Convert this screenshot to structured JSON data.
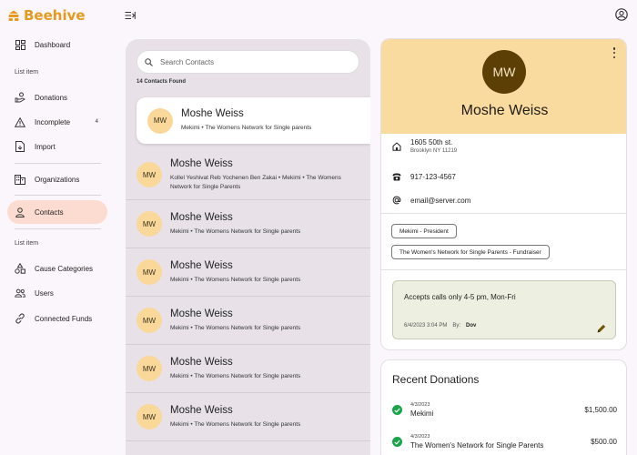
{
  "app": {
    "name": "Beehive",
    "brand_color": "#e69a1d",
    "accent_color": "#fcdcd0"
  },
  "sidebar": {
    "items": [
      {
        "label": "Dashboard",
        "icon": "dashboard-icon"
      },
      {
        "label": "Donations",
        "icon": "donations-icon"
      },
      {
        "label": "Incomplete",
        "icon": "warning-icon",
        "badge": "4"
      },
      {
        "label": "Import",
        "icon": "import-icon"
      },
      {
        "label": "Organizations",
        "icon": "organization-icon"
      },
      {
        "label": "Contacts",
        "icon": "person-icon",
        "active": true
      },
      {
        "label": "Cause Categories",
        "icon": "category-icon"
      },
      {
        "label": "Users",
        "icon": "users-icon"
      },
      {
        "label": "Connected Funds",
        "icon": "link-icon"
      }
    ],
    "section_labels": [
      "List item",
      "List item"
    ]
  },
  "contacts": {
    "search_placeholder": "Search Contacts",
    "found_text": "14 Contacts Found",
    "items": [
      {
        "initials": "MW",
        "name": "Moshe Weiss",
        "subtitle": "Mekimi • The Womens Network for Single parents",
        "selected": true
      },
      {
        "initials": "MW",
        "name": "Moshe Weiss",
        "subtitle": "Kollel Yeshivat Reb Yochenen Ben Zakai • Mekimi • The Womens Network for Single Parents"
      },
      {
        "initials": "MW",
        "name": "Moshe Weiss",
        "subtitle": "Mekimi • The Womens Network for Single parents"
      },
      {
        "initials": "MW",
        "name": "Moshe Weiss",
        "subtitle": "Mekimi • The Womens Network for Single parents"
      },
      {
        "initials": "MW",
        "name": "Moshe Weiss",
        "subtitle": "Mekimi • The Womens Network for Single parents"
      },
      {
        "initials": "MW",
        "name": "Moshe Weiss",
        "subtitle": "Mekimi • The Womens Network for Single parents"
      },
      {
        "initials": "MW",
        "name": "Moshe Weiss",
        "subtitle": "Mekimi • The Womens Network for Single parents"
      }
    ]
  },
  "detail": {
    "initials": "MW",
    "name": "Moshe Weiss",
    "address_line1": "1605 50th st.",
    "address_line2": "Brooklyn NY 11219",
    "phone": "917-123-4567",
    "email": "email@server.com",
    "roles": [
      "Mekimi - President",
      "The Women's Network for Single Parents - Fundraiser"
    ],
    "note": {
      "text": "Accepts calls only 4-5 pm, Mon-Fri",
      "date": "6/4/2023 3:04 PM",
      "by_label": "By:",
      "author": "Dov"
    }
  },
  "donations": {
    "title": "Recent Donations",
    "items": [
      {
        "date": "4/3/2023",
        "name": "Mekimi",
        "amount": "$1,500.00"
      },
      {
        "date": "4/3/2023",
        "name": "The Women's Network for Single Parents",
        "amount": "$500.00"
      }
    ]
  }
}
